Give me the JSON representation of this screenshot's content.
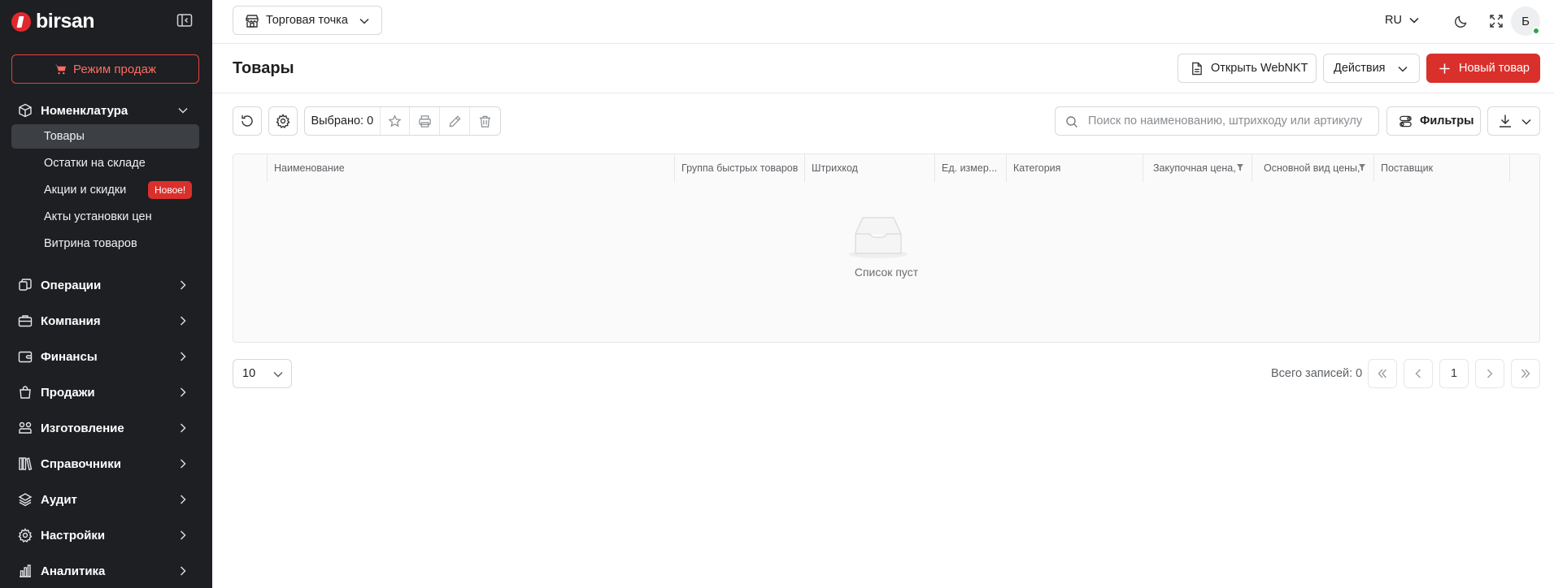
{
  "sidebar": {
    "brand": "birsan",
    "sale_mode_label": "Режим продаж",
    "sections": [
      {
        "label": "Номенклатура",
        "icon": "cube-icon",
        "expanded": true
      },
      {
        "label": "Операции",
        "icon": "operations-icon"
      },
      {
        "label": "Компания",
        "icon": "briefcase-icon"
      },
      {
        "label": "Финансы",
        "icon": "wallet-icon"
      },
      {
        "label": "Продажи",
        "icon": "shopping-bag-icon"
      },
      {
        "label": "Изготовление",
        "icon": "production-icon"
      },
      {
        "label": "Справочники",
        "icon": "books-icon"
      },
      {
        "label": "Аудит",
        "icon": "layers-icon"
      },
      {
        "label": "Настройки",
        "icon": "gear-icon"
      },
      {
        "label": "Аналитика",
        "icon": "chart-icon"
      }
    ],
    "sub_items": [
      {
        "label": "Товары",
        "active": true
      },
      {
        "label": "Остатки на складе"
      },
      {
        "label": "Акции и скидки",
        "badge": "Новое!"
      },
      {
        "label": "Акты установки цен"
      },
      {
        "label": "Витрина товаров"
      }
    ]
  },
  "topbar": {
    "store_label": "Торговая точка",
    "language": "RU",
    "avatar_initial": "Б"
  },
  "header": {
    "title": "Товары",
    "open_webnkt_label": "Открыть WebNKT",
    "actions_label": "Действия",
    "new_item_label": "Новый товар"
  },
  "toolbar": {
    "selected_label": "Выбрано: 0",
    "search_placeholder": "Поиск по наименованию, штрихкоду или артикулу",
    "filters_label": "Фильтры"
  },
  "table": {
    "columns": [
      "Наименование",
      "Группа быстрых товаров",
      "Штрихкод",
      "Ед. измер...",
      "Категория",
      "Закупочная цена,",
      "Основной вид цены,",
      "Поставщик"
    ],
    "empty_text": "Список пуст"
  },
  "pagination": {
    "page_size": "10",
    "total_label": "Всего записей: 0",
    "current_page": "1"
  },
  "colors": {
    "accent": "#d9302c",
    "sidebar_bg": "#1d1f22",
    "online_status": "#2ea44f"
  }
}
